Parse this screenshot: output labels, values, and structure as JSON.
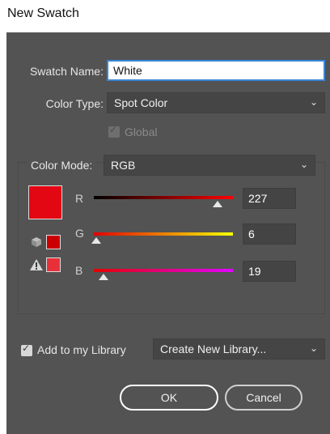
{
  "window": {
    "title": "New Swatch"
  },
  "swatch_name": {
    "label": "Swatch Name:",
    "value": "White"
  },
  "color_type": {
    "label": "Color Type:",
    "value": "Spot Color"
  },
  "global": {
    "label": "Global",
    "checked": true,
    "enabled": false
  },
  "color_mode": {
    "label": "Color Mode:",
    "value": "RGB"
  },
  "channels": [
    {
      "label": "R",
      "value": "227",
      "fraction": 0.89
    },
    {
      "label": "G",
      "value": "6",
      "fraction": 0.02
    },
    {
      "label": "B",
      "value": "19",
      "fraction": 0.07
    }
  ],
  "colors": {
    "swatch": "#e30613",
    "out_of_gamut_web": "#cc0000",
    "out_of_gamut_print": "#e8303a",
    "accent_focus": "#3a86d6"
  },
  "icons": {
    "web_safe": "cube-icon",
    "gamut_warning": "warning-icon",
    "dropdown": "chevron-down-icon",
    "check": "checkmark-icon"
  },
  "library": {
    "checkbox_label": "Add to my Library",
    "checked": true,
    "select_value": "Create New Library..."
  },
  "buttons": {
    "ok": "OK",
    "cancel": "Cancel"
  }
}
